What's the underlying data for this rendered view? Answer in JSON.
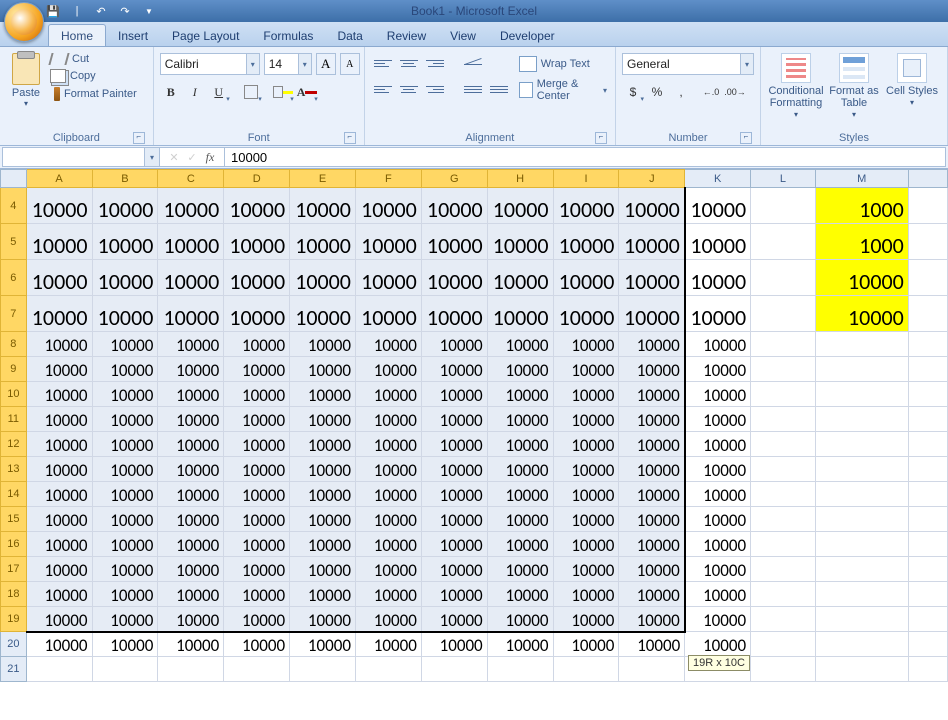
{
  "title": "Book1 - Microsoft Excel",
  "tabs": [
    "Home",
    "Insert",
    "Page Layout",
    "Formulas",
    "Data",
    "Review",
    "View",
    "Developer"
  ],
  "active_tab": 0,
  "ribbon": {
    "clipboard": {
      "label": "Clipboard",
      "paste": "Paste",
      "cut": "Cut",
      "copy": "Copy",
      "format_painter": "Format Painter"
    },
    "font": {
      "label": "Font",
      "name": "Calibri",
      "size": "14",
      "grow": "A",
      "shrink": "A",
      "bold": "B",
      "italic": "I",
      "underline": "U"
    },
    "alignment": {
      "label": "Alignment",
      "wrap": "Wrap Text",
      "merge": "Merge & Center"
    },
    "number": {
      "label": "Number",
      "format": "General",
      "currency": "$",
      "percent": "%",
      "comma": ",",
      "inc": ".0",
      "dec": ".00"
    },
    "styles": {
      "label": "Styles",
      "cond": "Conditional Formatting",
      "table": "Format as Table",
      "cell": "Cell Styles"
    }
  },
  "namebox": "",
  "fx": "fx",
  "formula_value": "10000",
  "columns": [
    "A",
    "B",
    "C",
    "D",
    "E",
    "F",
    "G",
    "H",
    "I",
    "J",
    "K",
    "L",
    "M"
  ],
  "visible_row_start": 4,
  "visible_row_end": 21,
  "cell_value": "10000",
  "m_values": {
    "4": "1000",
    "5": "1000",
    "6": "10000",
    "7": "10000"
  },
  "size_tip": "19R x 10C"
}
